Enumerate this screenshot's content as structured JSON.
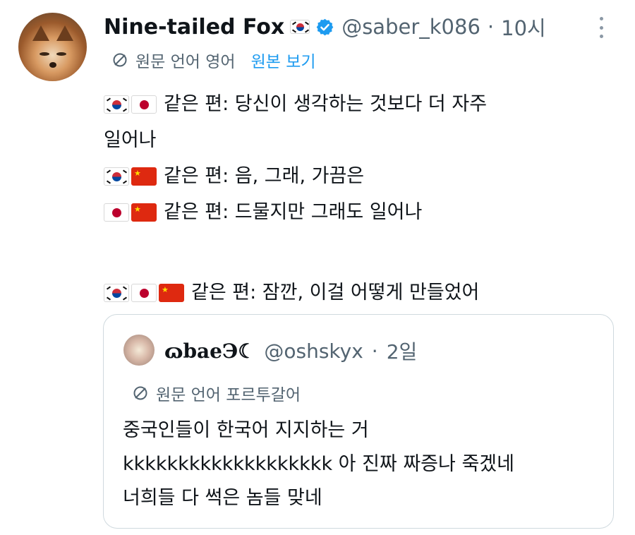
{
  "author": {
    "name": "Nine-tailed Fox",
    "handle": "@saber_k086",
    "separator": "·",
    "time": "10시",
    "name_flag": "kr",
    "verified_icon": "verified-badge-icon"
  },
  "translation": {
    "label": "원문 언어 영어",
    "link": "원본 보기"
  },
  "tweet": {
    "lines": [
      {
        "flags": [
          "kr",
          "jp"
        ],
        "text": "같은 편: 당신이 생각하는 것보다 더 자주"
      },
      {
        "flags": [],
        "text": "일어나"
      },
      {
        "flags": [
          "kr",
          "cn"
        ],
        "text": "같은 편: 음, 그래, 가끔은"
      },
      {
        "flags": [
          "jp",
          "cn"
        ],
        "text": "같은 편: 드물지만 그래도 일어나"
      },
      {
        "flags": [
          "kr",
          "jp",
          "cn"
        ],
        "text": "같은 편: 잠깐, 이걸 어떻게 만들었어"
      }
    ]
  },
  "quote": {
    "name": "ɷbaeЭ☾",
    "handle": "@oshskyx",
    "separator": "·",
    "time": "2일",
    "translation_label": "원문 언어 포르투갈어",
    "lines": [
      "중국인들이 한국어 지지하는 거",
      "kkkkkkkkkkkkkkkkkkk 아 진짜 짜증나 죽겠네",
      "너희들 다 썩은 놈들 맞네"
    ]
  },
  "colors": {
    "text": "#0f1419",
    "secondary": "#536471",
    "link": "#1d9bf0",
    "verified": "#1d9bf0",
    "border": "#cfd9de"
  }
}
